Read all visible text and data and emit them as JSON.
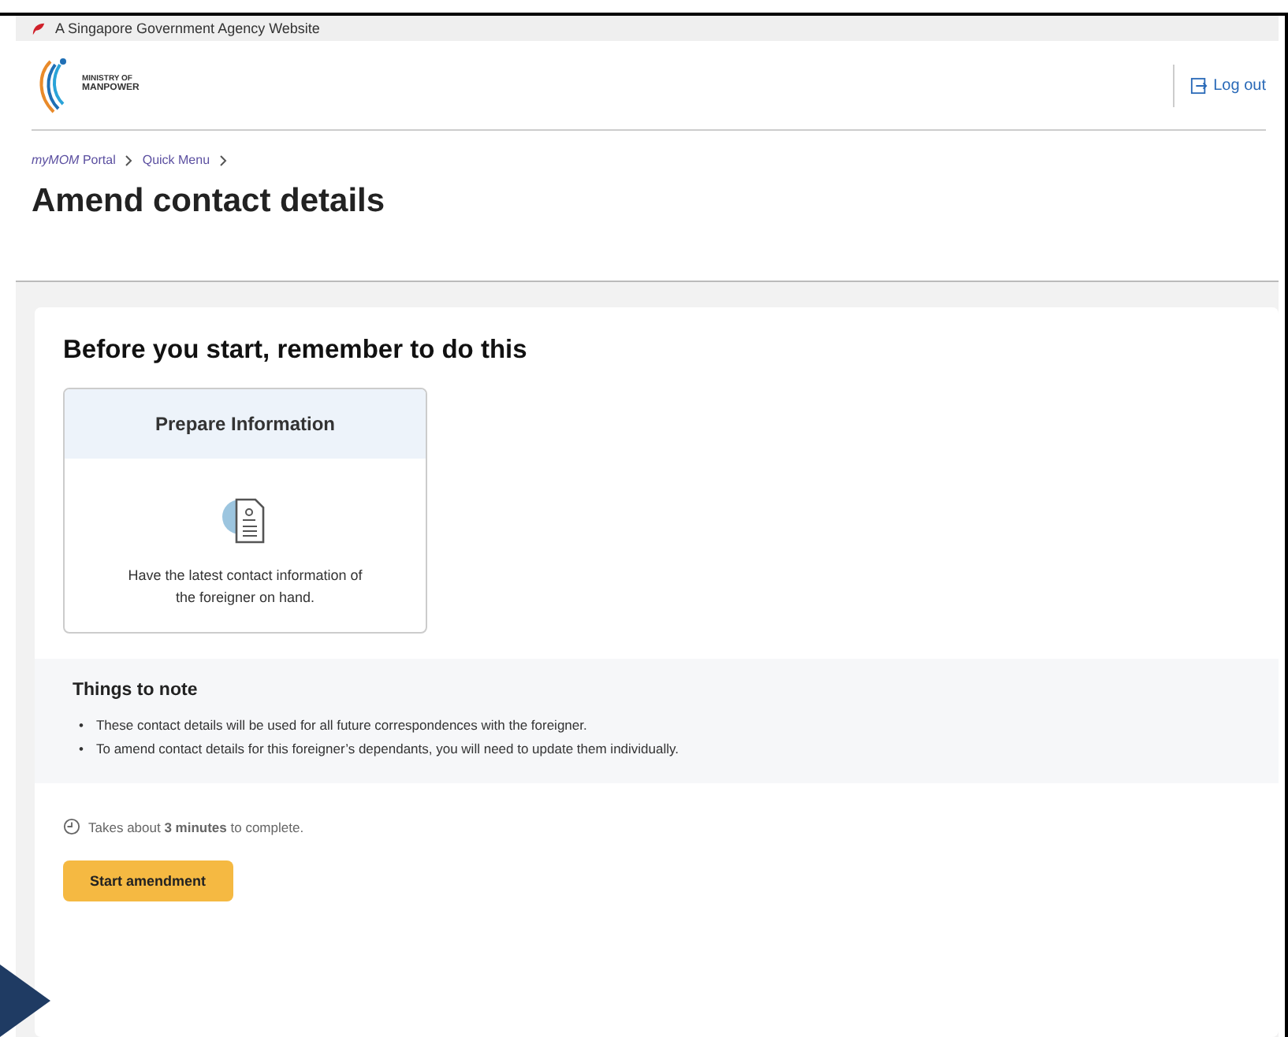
{
  "gov_banner": {
    "text": "A Singapore Government Agency Website"
  },
  "header": {
    "logo_text": [
      "MINISTRY OF",
      "MANPOWER"
    ],
    "logout": "Log out"
  },
  "breadcrumb": [
    "*myMOM* Portal",
    "Quick Menu"
  ],
  "title": "Amend contact details",
  "card": {
    "heading": "Before you start, remember to do this",
    "prepare": {
      "title": "Prepare Information",
      "text": "Have the latest contact information of the foreigner on hand."
    },
    "notes": {
      "heading": "Things to note",
      "items": [
        {
          "bullet": "•",
          "text": "These contact details will be used for all future correspondences with the foreigner."
        },
        {
          "bullet": "•",
          "text": "To amend contact details for this foreigner’s dependants, you will need to update them individually."
        }
      ]
    },
    "duration": "Takes about **3 minutes** to complete.",
    "button": "Start amendment"
  }
}
